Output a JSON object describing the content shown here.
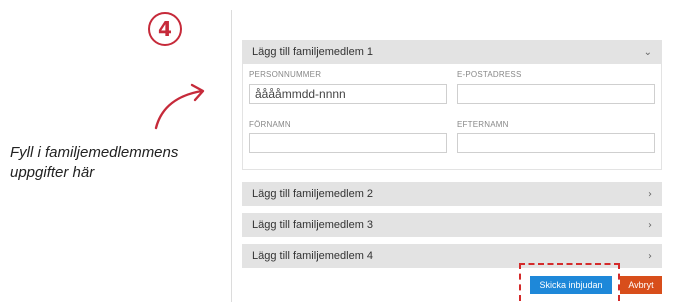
{
  "step": {
    "number": "4",
    "color": "#c62a3a"
  },
  "annotation": {
    "text": "Fyll i familjemedlemmens uppgifter här"
  },
  "accordion": {
    "items": [
      {
        "label": "Lägg till familjemedlem 1",
        "expanded": true
      },
      {
        "label": "Lägg till familjemedlem 2",
        "expanded": false
      },
      {
        "label": "Lägg till familjemedlem 3",
        "expanded": false
      },
      {
        "label": "Lägg till familjemedlem 4",
        "expanded": false
      }
    ]
  },
  "form": {
    "personnummer_label": "PERSONNUMMER",
    "personnummer_placeholder": "ååååmmdd-nnnn",
    "email_label": "E-POSTADRESS",
    "firstname_label": "FÖRNAMN",
    "lastname_label": "EFTERNAMN"
  },
  "actions": {
    "send_label": "Skicka inbjudan",
    "cancel_label": "Avbryt",
    "send_color": "#1e88d9",
    "cancel_color": "#d84e1b",
    "highlight_color": "#d42a2a"
  },
  "icons": {
    "expanded": "chevron-down-icon",
    "collapsed": "chevron-right-icon"
  }
}
